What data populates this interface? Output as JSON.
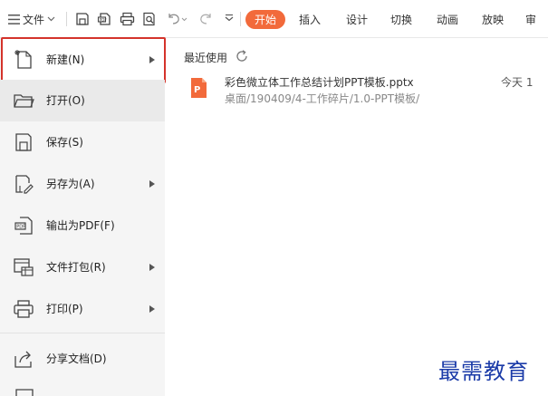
{
  "toolbar": {
    "file_menu_label": "文件",
    "quick_icons": [
      "save-icon",
      "export-pdf-icon",
      "print-icon",
      "print-preview-icon",
      "undo-icon",
      "redo-icon",
      "customize-icon"
    ],
    "tabs": [
      "开始",
      "插入",
      "设计",
      "切换",
      "动画",
      "放映",
      "审"
    ],
    "active_tab": "开始"
  },
  "left_menu": {
    "items": [
      {
        "label": "新建(N)",
        "icon": "new-document-icon",
        "has_submenu": true,
        "highlighted": true
      },
      {
        "label": "打开(O)",
        "icon": "open-folder-icon",
        "has_submenu": false,
        "selected": true
      },
      {
        "label": "保存(S)",
        "icon": "save-icon",
        "has_submenu": false
      },
      {
        "label": "另存为(A)",
        "icon": "save-as-icon",
        "has_submenu": true
      },
      {
        "label": "输出为PDF(F)",
        "icon": "export-pdf-icon",
        "has_submenu": false
      },
      {
        "label": "文件打包(R)",
        "icon": "package-icon",
        "has_submenu": true
      },
      {
        "label": "打印(P)",
        "icon": "print-icon",
        "has_submenu": true
      },
      {
        "label": "分享文档(D)",
        "icon": "share-icon",
        "has_submenu": false
      }
    ]
  },
  "recent": {
    "title": "最近使用",
    "files": [
      {
        "name": "彩色微立体工作总结计划PPT模板.pptx",
        "path": "桌面/190409/4-工作碎片/1.0-PPT模板/",
        "time": "今天 1"
      }
    ]
  },
  "watermark": "最需教育",
  "colors": {
    "accent": "#f26a3b",
    "highlight_border": "#d4332b",
    "panel_bg": "#f5f5f5",
    "watermark": "#1b3ba8"
  }
}
